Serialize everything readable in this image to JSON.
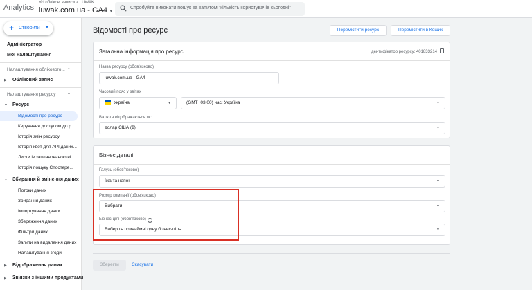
{
  "topbar": {
    "brand": "Analytics",
    "account_crumb": "Усі облікові записи > LUWAK",
    "account_name": "luwak.com.ua - GA4",
    "search_placeholder": "Спробуйте виконати пошук за запитом \"кількість користувачів сьогодні\""
  },
  "sidebar": {
    "create_label": "Створити",
    "admin": "Адміністратор",
    "my_settings": "Мої налаштування",
    "account_settings_section": "Налаштування облікового...",
    "account": "Обліковий запис",
    "property_settings_section": "Налаштування ресурсу",
    "property": "Ресурс",
    "property_items": [
      "Відомості про ресурс",
      "Керування доступом до р...",
      "Історія змін ресурсу",
      "Історія квот для API даних...",
      "Листи із запланованою ві...",
      "Історія пошуку Спостере..."
    ],
    "data_collection": "Збирання й змінення даних",
    "data_items": [
      "Потоки даних",
      "Збирання даних",
      "Імпортування даних",
      "Збереження даних",
      "Фільтри даних",
      "Запити на видалення даних",
      "Налаштування згоди"
    ],
    "data_display": "Відображення даних",
    "product_links": "Зв'язки з іншими продуктами"
  },
  "main": {
    "title": "Відомості про ресурс",
    "move_property_btn": "Перемістити ресурс",
    "move_trash_btn": "Перемістити в Кошик",
    "general": {
      "title": "Загальна інформація про ресурс",
      "property_id": "Ідентифікатор ресурсу: 401833214",
      "name_label": "Назва ресурсу (обов'язково)",
      "name_value": "luwak.com.ua - GA4",
      "tz_label": "Часовий пояс у звітах",
      "tz_country": "Україна",
      "tz_value": "(GMT+03:00) час: Україна",
      "currency_label": "Валюта відображається як:",
      "currency_value": "долар США ($)"
    },
    "business": {
      "title": "Бізнес деталі",
      "industry_label": "Галузь (обов'язково)",
      "industry_value": "Їжа та напої",
      "size_label": "Розмір компанії (обов'язково)",
      "size_value": "Вибрати",
      "goals_label": "Бізнес-цілі (обов'язково)",
      "goals_value": "Виберіть принаймні одну бізнес-ціль"
    },
    "save_btn": "Зберегти",
    "cancel_btn": "Скасувати"
  },
  "colors": {
    "accent": "#1a73e8",
    "highlight": "#d93025",
    "active_nav_bg": "#e8f0fe"
  }
}
